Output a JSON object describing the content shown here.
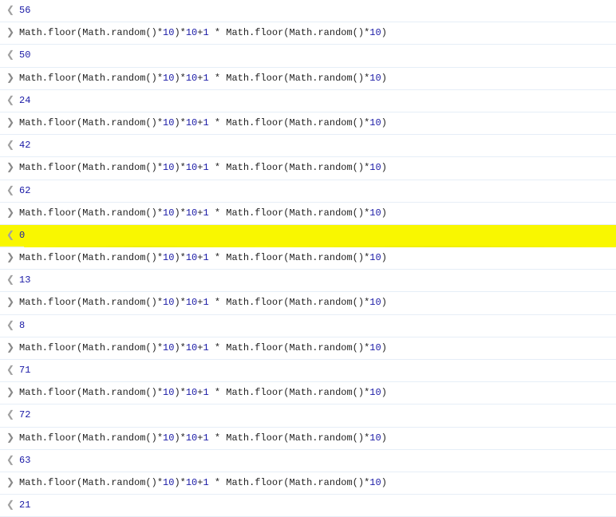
{
  "expression_parts": {
    "p1": "Math.floor(Math.random()*",
    "n1": "10",
    "p2": ")*",
    "n2": "10",
    "p3": "+",
    "n3": "1",
    "p4": " * Math.floor(Math.random()*",
    "n4": "10",
    "p5": ")"
  },
  "input_arrow": "❯",
  "output_arrow": "❮",
  "entries": [
    {
      "output": "56",
      "highlight": false,
      "show_input": false
    },
    {
      "output": "50",
      "highlight": false,
      "show_input": true
    },
    {
      "output": "24",
      "highlight": false,
      "show_input": true
    },
    {
      "output": "42",
      "highlight": false,
      "show_input": true
    },
    {
      "output": "62",
      "highlight": false,
      "show_input": true
    },
    {
      "output": "0",
      "highlight": true,
      "show_input": true
    },
    {
      "output": "13",
      "highlight": false,
      "show_input": true
    },
    {
      "output": "8",
      "highlight": false,
      "show_input": true
    },
    {
      "output": "71",
      "highlight": false,
      "show_input": true
    },
    {
      "output": "72",
      "highlight": false,
      "show_input": true
    },
    {
      "output": "63",
      "highlight": false,
      "show_input": true
    },
    {
      "output": "21",
      "highlight": false,
      "show_input": true
    }
  ]
}
